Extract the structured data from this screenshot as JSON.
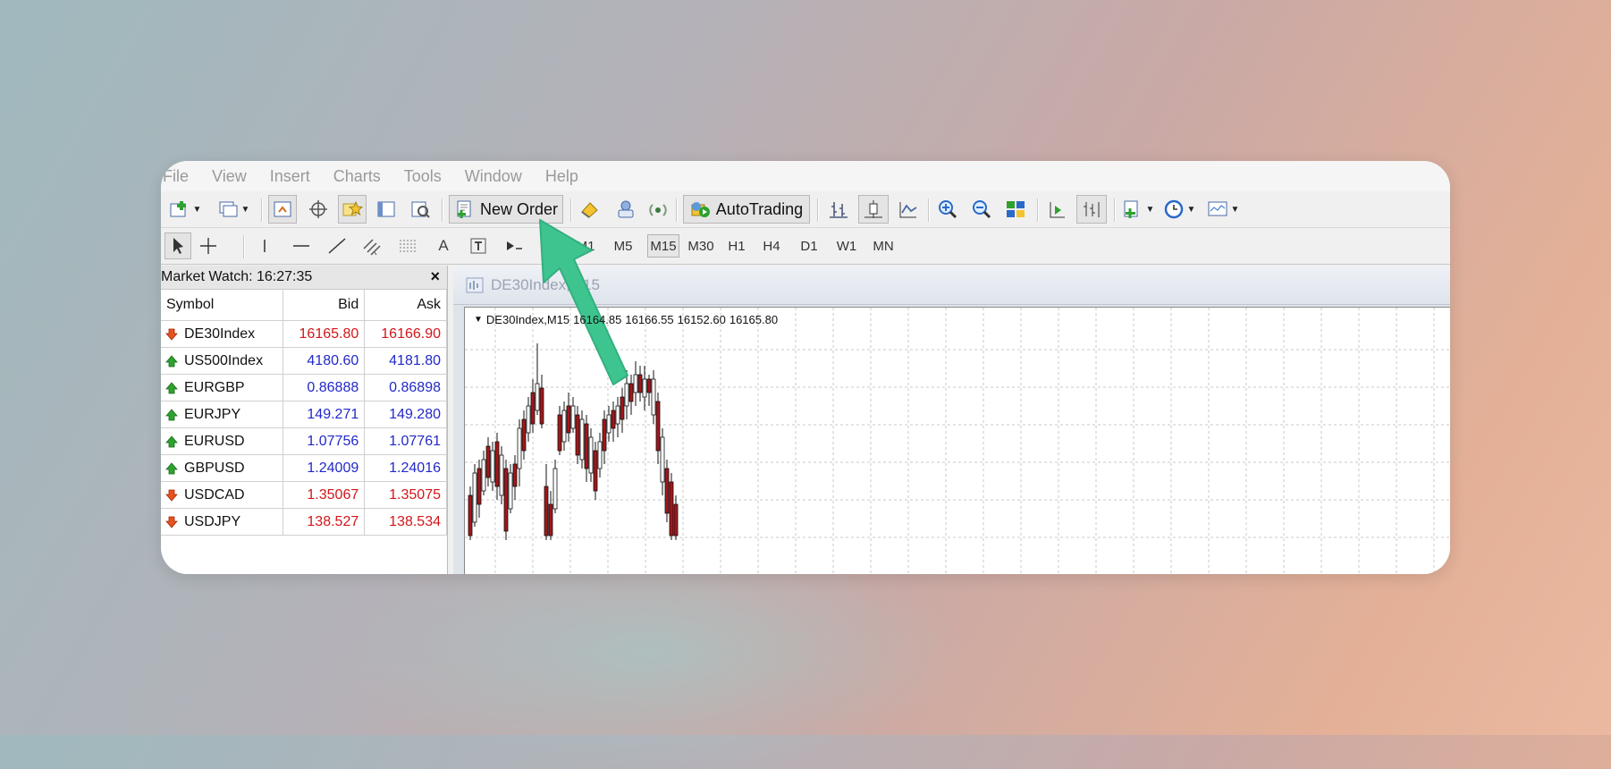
{
  "menu": [
    "File",
    "View",
    "Insert",
    "Charts",
    "Tools",
    "Window",
    "Help"
  ],
  "toolbar": {
    "new_order_label": "New Order",
    "autotrading_label": "AutoTrading"
  },
  "timeframes": [
    "M1",
    "M5",
    "M15",
    "M30",
    "H1",
    "H4",
    "D1",
    "W1",
    "MN"
  ],
  "active_timeframe": "M15",
  "market_watch": {
    "title": "Market Watch: 16:27:35",
    "close": "×",
    "columns": [
      "Symbol",
      "Bid",
      "Ask"
    ],
    "rows": [
      {
        "symbol": "DE30Index",
        "bid": "16165.80",
        "ask": "16166.90",
        "dir": "down"
      },
      {
        "symbol": "US500Index",
        "bid": "4180.60",
        "ask": "4181.80",
        "dir": "up"
      },
      {
        "symbol": "EURGBP",
        "bid": "0.86888",
        "ask": "0.86898",
        "dir": "up"
      },
      {
        "symbol": "EURJPY",
        "bid": "149.271",
        "ask": "149.280",
        "dir": "up"
      },
      {
        "symbol": "EURUSD",
        "bid": "1.07756",
        "ask": "1.07761",
        "dir": "up"
      },
      {
        "symbol": "GBPUSD",
        "bid": "1.24009",
        "ask": "1.24016",
        "dir": "up"
      },
      {
        "symbol": "USDCAD",
        "bid": "1.35067",
        "ask": "1.35075",
        "dir": "down"
      },
      {
        "symbol": "USDJPY",
        "bid": "138.527",
        "ask": "138.534",
        "dir": "down"
      }
    ]
  },
  "chart": {
    "window_title": "DE30Index,M15",
    "header_symbol": "DE30Index,M15",
    "header_values": [
      "16164.85",
      "16166.55",
      "16152.60",
      "16165.80"
    ]
  },
  "colors": {
    "bid_up": "#2328c8",
    "bid_down": "#d2161a",
    "arrow": "#3ec48f",
    "candle_bull": "#ffffff",
    "candle_bear": "#a3161a"
  }
}
